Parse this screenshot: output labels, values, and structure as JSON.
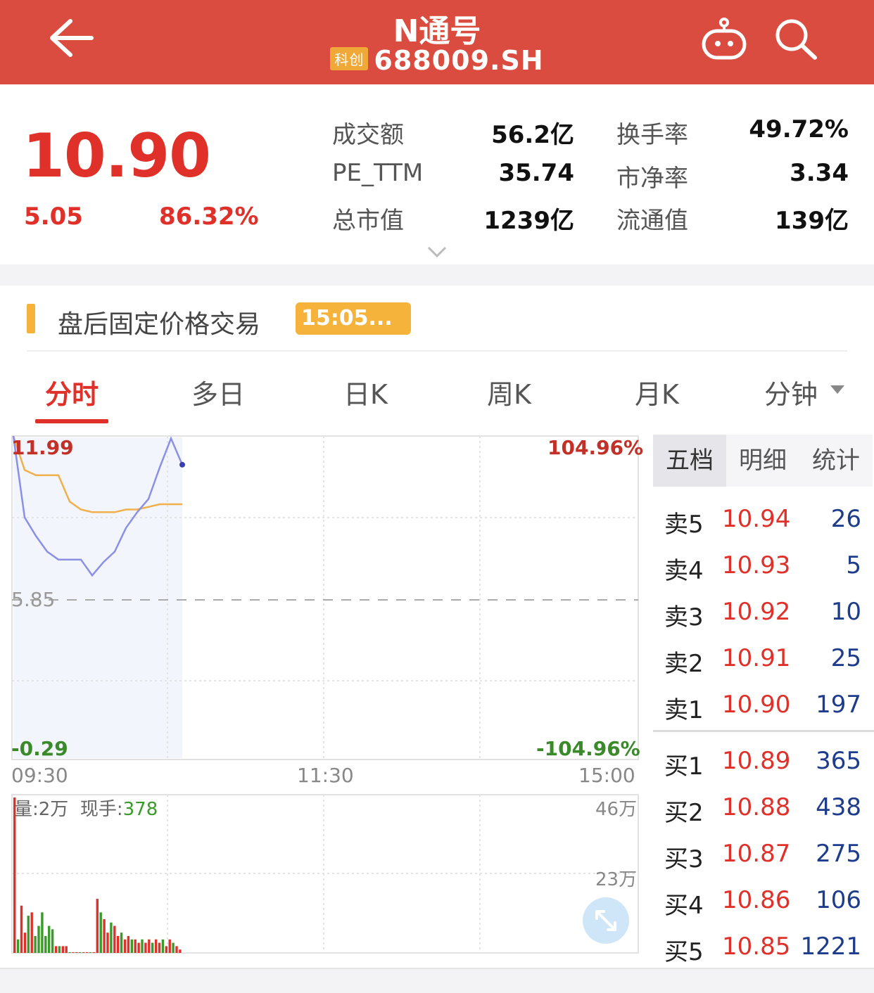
{
  "header": {
    "title": "N通号",
    "board_badge": "科创",
    "code": "688009.SH"
  },
  "quote": {
    "price": "10.90",
    "change": "5.05",
    "change_pct": "86.32%",
    "stats": [
      {
        "label": "成交额",
        "value": "56.2亿"
      },
      {
        "label": "换手率",
        "value": "49.72%"
      },
      {
        "label": "PE_TTM",
        "value": "35.74"
      },
      {
        "label": "市净率",
        "value": "3.34"
      },
      {
        "label": "总市值",
        "value": "1239亿"
      },
      {
        "label": "流通值",
        "value": "139亿"
      }
    ]
  },
  "after_hours": {
    "label": "盘后固定价格交易",
    "time": "15:05..."
  },
  "tabs": [
    "分时",
    "多日",
    "日K",
    "周K",
    "月K",
    "分钟"
  ],
  "active_tab": "分时",
  "chart": {
    "y_top": "11.99",
    "y_mid": "5.85",
    "y_bottom": "-0.29",
    "pct_top": "104.96%",
    "pct_bottom": "-104.96%",
    "x_labels": [
      "09:30",
      "11:30",
      "15:00"
    ],
    "volume_label": "量:2万",
    "current_hand_label": "现手:",
    "current_hand": "378",
    "vol_top": "46万",
    "vol_mid": "23万"
  },
  "chart_data": {
    "type": "line",
    "series": [
      {
        "values": [
          11.99,
          8.9,
          8.2,
          7.6,
          7.3,
          7.3,
          7.3,
          6.7,
          7.2,
          7.6,
          8.5,
          9.1,
          9.6,
          10.8,
          11.9,
          10.9
        ]
      },
      {
        "values": [
          11.99,
          10.7,
          10.5,
          10.5,
          10.5,
          9.5,
          9.2,
          9.1,
          9.1,
          9.1,
          9.2,
          9.2,
          9.3,
          9.4,
          9.4,
          9.4
        ]
      }
    ],
    "ylim": [
      -0.29,
      11.99
    ],
    "volumes": [
      46,
      4,
      14,
      6,
      11,
      12,
      5,
      8,
      12,
      5,
      8,
      7,
      2,
      2,
      2,
      2,
      0,
      0,
      0,
      0,
      0,
      0,
      0,
      0,
      16,
      12,
      10,
      6,
      9,
      8,
      5,
      6,
      4,
      5,
      4,
      4,
      3,
      4,
      3,
      4,
      3,
      4,
      3,
      4,
      2,
      4,
      3,
      2,
      1
    ]
  },
  "orderbook": {
    "tabs": [
      "五档",
      "明细",
      "统计"
    ],
    "asks": [
      {
        "name": "卖5",
        "price": "10.94",
        "vol": "26"
      },
      {
        "name": "卖4",
        "price": "10.93",
        "vol": "5"
      },
      {
        "name": "卖3",
        "price": "10.92",
        "vol": "10"
      },
      {
        "name": "卖2",
        "price": "10.91",
        "vol": "25"
      },
      {
        "name": "卖1",
        "price": "10.90",
        "vol": "197"
      }
    ],
    "bids": [
      {
        "name": "买1",
        "price": "10.89",
        "vol": "365"
      },
      {
        "name": "买2",
        "price": "10.88",
        "vol": "438"
      },
      {
        "name": "买3",
        "price": "10.87",
        "vol": "275"
      },
      {
        "name": "买4",
        "price": "10.86",
        "vol": "106"
      },
      {
        "name": "买5",
        "price": "10.85",
        "vol": "1221"
      }
    ]
  },
  "colors": {
    "header": "#d94c3f",
    "up": "#e0302a",
    "down": "#3a9a2a",
    "price_line": "#8b8fe6",
    "avg_line": "#f0b04a",
    "badge": "#f5b33c"
  }
}
